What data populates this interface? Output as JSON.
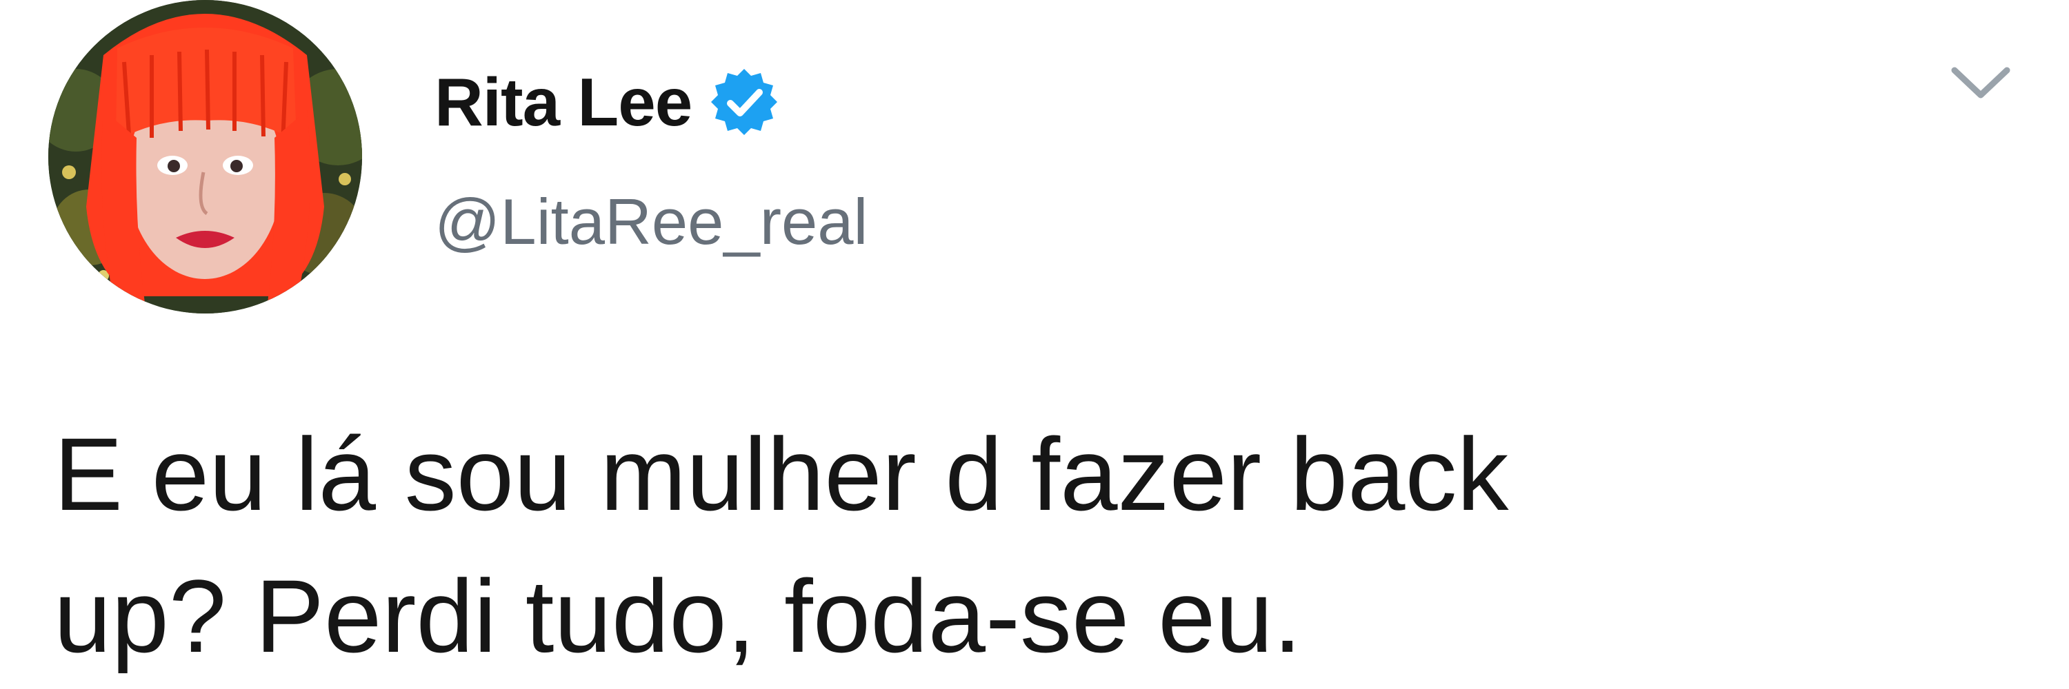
{
  "user": {
    "display_name": "Rita Lee",
    "handle": "@LitaRee_real",
    "verified": true,
    "verified_color": "#1da1f2"
  },
  "tweet": {
    "lines": [
      "E eu lá sou mulher d fazer back",
      "up? Perdi tudo, foda-se eu."
    ]
  },
  "icons": {
    "avatar": "profile-photo-red-hair",
    "verified": "verified-badge-icon",
    "menu": "chevron-down-icon"
  },
  "colors": {
    "name": "#141414",
    "handle": "#67707a",
    "text": "#161616",
    "chevron": "#9aa3ab",
    "hair": "#ff3b1f"
  }
}
